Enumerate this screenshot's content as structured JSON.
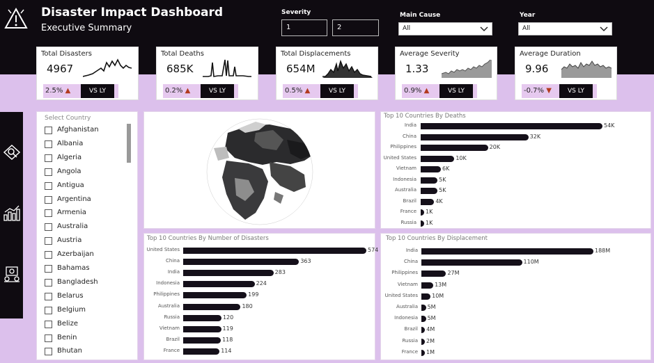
{
  "header": {
    "title": "Disaster Impact Dashboard",
    "subtitle": "Executive Summary"
  },
  "filters": {
    "severity": {
      "label": "Severity",
      "min": "1",
      "max": "2"
    },
    "main_cause": {
      "label": "Main Cause",
      "value": "All"
    },
    "year": {
      "label": "Year",
      "value": "All"
    }
  },
  "kpis": [
    {
      "title": "Total Disasters",
      "value": "4967",
      "change": "2.5%",
      "direction": "up",
      "vs": "VS LY"
    },
    {
      "title": "Total Deaths",
      "value": "685K",
      "change": "0.2%",
      "direction": "up",
      "vs": "VS LY"
    },
    {
      "title": "Total Displacements",
      "value": "654M",
      "change": "0.5%",
      "direction": "up",
      "vs": "VS LY"
    },
    {
      "title": "Average Severity",
      "value": "1.33",
      "change": "0.9%",
      "direction": "up",
      "vs": "VS LY"
    },
    {
      "title": "Average Duration",
      "value": "9.96",
      "change": "-0.7%",
      "direction": "down",
      "vs": "VS LY"
    }
  ],
  "nav": {
    "items": [
      "overview-icon",
      "bar-chart-icon",
      "analysis-icon"
    ]
  },
  "country_slicer": {
    "label": "Select Country",
    "items": [
      "Afghanistan",
      "Albania",
      "Algeria",
      "Angola",
      "Antigua",
      "Argentina",
      "Armenia",
      "Australia",
      "Austria",
      "Azerbaijan",
      "Bahamas",
      "Bangladesh",
      "Belarus",
      "Belgium",
      "Belize",
      "Benin",
      "Bhutan"
    ]
  },
  "chart_data": [
    {
      "type": "bar",
      "title": "Top 10 Countries By Deaths",
      "categories": [
        "India",
        "China",
        "Philippines",
        "United States",
        "Vietnam",
        "Indonesia",
        "Australia",
        "Brazil",
        "France",
        "Russia"
      ],
      "values": [
        54000,
        32000,
        20000,
        10000,
        6000,
        5000,
        5000,
        4000,
        1000,
        1000
      ],
      "labels": [
        "54K",
        "32K",
        "20K",
        "10K",
        "6K",
        "5K",
        "5K",
        "4K",
        "1K",
        "1K"
      ]
    },
    {
      "type": "bar",
      "title": "Top 10 Countries By Number of Disasters",
      "categories": [
        "United States",
        "China",
        "India",
        "Indonesia",
        "Philippines",
        "Australia",
        "Russia",
        "Vietnam",
        "Brazil",
        "France"
      ],
      "values": [
        574,
        363,
        283,
        224,
        199,
        180,
        120,
        119,
        118,
        114
      ],
      "labels": [
        "574",
        "363",
        "283",
        "224",
        "199",
        "180",
        "120",
        "119",
        "118",
        "114"
      ]
    },
    {
      "type": "bar",
      "title": "Top 10 Countries By Displacement",
      "categories": [
        "India",
        "China",
        "Philippines",
        "Vietnam",
        "United States",
        "Australia",
        "Indonesia",
        "Brazil",
        "Russia",
        "France"
      ],
      "values": [
        188,
        110,
        27,
        13,
        10,
        5,
        5,
        4,
        2,
        1
      ],
      "labels": [
        "188M",
        "110M",
        "27M",
        "13M",
        "10M",
        "5M",
        "5M",
        "4M",
        "2M",
        "1M"
      ]
    }
  ]
}
